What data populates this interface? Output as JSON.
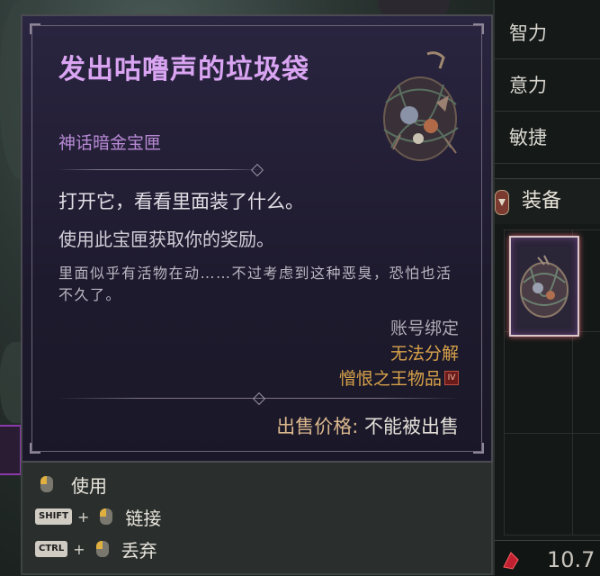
{
  "stats_panel": {
    "intelligence": "智力",
    "willpower": "意力",
    "dexterity": "敏捷",
    "equipment_label": "装备",
    "gold_amount": "10.7"
  },
  "tooltip": {
    "item_name": "发出咕噜声的垃圾袋",
    "item_type": "神话暗金宝匣",
    "description_1": "打开它，看看里面装了什么。",
    "description_2": "使用此宝匣获取你的奖励。",
    "flavor_text": "里面似乎有活物在动……不过考虑到这种恶臭，恐怕也活不久了。",
    "account_bound": "账号绑定",
    "cannot_salvage": "无法分解",
    "expansion_item": "憎恨之王物品",
    "expansion_badge": "IV",
    "sell_label": "出售价格:",
    "sell_value": "不能被出售"
  },
  "actions": {
    "use_label": "使用",
    "shift_key": "SHIFT",
    "link_label": "链接",
    "ctrl_key": "CTRL",
    "drop_label": "丢弃"
  },
  "colors": {
    "mythic_purple": "#d9a4f2",
    "orange_note": "#d8a24a"
  }
}
